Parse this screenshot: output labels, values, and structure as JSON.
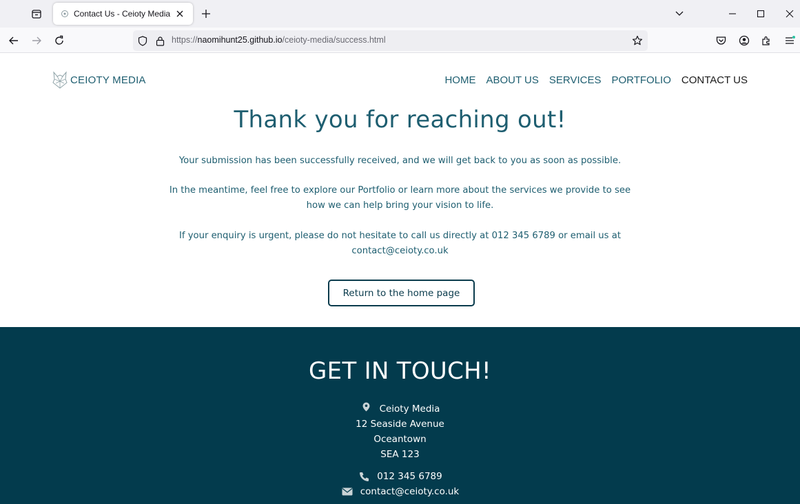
{
  "browser": {
    "tab_title": "Contact Us - Ceioty Media",
    "url_prefix": "https://",
    "url_host": "naomihunt25.github.io",
    "url_path": "/ceioty-media/success.html",
    "icons": [
      "tab-list-icon",
      "ceioty-favicon",
      "close-tab-icon",
      "new-tab-icon",
      "tab-overflow-chevron-icon",
      "minimize-icon",
      "maximize-icon",
      "window-close-icon",
      "back-icon",
      "forward-icon",
      "reload-icon",
      "shield-icon",
      "lock-icon",
      "bookmark-star-icon",
      "pocket-icon",
      "account-icon",
      "extensions-icon",
      "app-menu-icon"
    ]
  },
  "site": {
    "logo_text": "CEIOTY MEDIA",
    "nav": [
      {
        "label": "HOME"
      },
      {
        "label": "ABOUT US"
      },
      {
        "label": "SERVICES"
      },
      {
        "label": "PORTFOLIO"
      },
      {
        "label": "CONTACT US"
      }
    ]
  },
  "success": {
    "heading": "Thank you for reaching out!",
    "p1": "Your submission has been successfully received, and we will get back to you as soon as possible.",
    "p2": "In the meantime, feel free to explore our Portfolio or learn more about the services we provide to see how we can help bring your vision to life.",
    "p3": "If your enquiry is urgent, please do not hesitate to call us directly at 012 345 6789 or email us at contact@ceioty.co.uk",
    "button_label": "Return to the home page"
  },
  "footer": {
    "heading": "GET IN TOUCH!",
    "address": [
      "Ceioty Media",
      "12 Seaside Avenue",
      "Oceantown",
      "SEA 123"
    ],
    "phone": "012 345 6789",
    "email": "contact@ceioty.co.uk"
  },
  "colors": {
    "brand_teal": "#1e5e70",
    "footer_bg": "#033b4d",
    "button_border": "#0a3b4c"
  }
}
